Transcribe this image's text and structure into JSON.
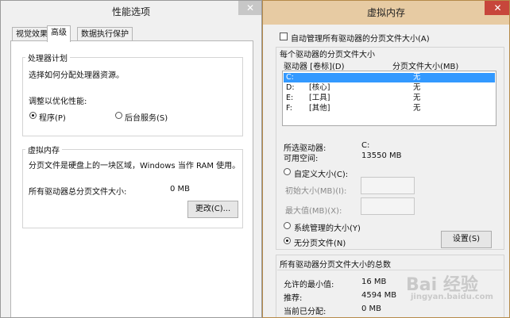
{
  "perf": {
    "title": "性能选项",
    "close": "✕",
    "tabs": [
      "视觉效果",
      "高级",
      "数据执行保护"
    ],
    "cpu": {
      "group_title": "处理器计划",
      "desc": "选择如何分配处理器资源。",
      "adjust_label": "调整以优化性能:",
      "opt_programs": "程序(P)",
      "opt_services": "后台服务(S)"
    },
    "vm": {
      "group_title": "虚拟内存",
      "desc": "分页文件是硬盘上的一块区域，Windows 当作 RAM 使用。",
      "total_label": "所有驱动器总分页文件大小:",
      "total_value": "0 MB",
      "change_button": "更改(C)..."
    }
  },
  "vmem": {
    "title": "虚拟内存",
    "close": "✕",
    "auto_label": "自动管理所有驱动器的分页文件大小(A)",
    "per_drive_title": "每个驱动器的分页文件大小",
    "col_drive": "驱动器 [卷标](D)",
    "col_size": "分页文件大小(MB)",
    "drives": [
      {
        "drive": "C:",
        "label": "",
        "size": "无"
      },
      {
        "drive": "D:",
        "label": "[核心]",
        "size": "无"
      },
      {
        "drive": "E:",
        "label": "[工具]",
        "size": "无"
      },
      {
        "drive": "F:",
        "label": "[其他]",
        "size": "无"
      }
    ],
    "selected_drive_label": "所选驱动器:",
    "selected_drive_value": "C:",
    "free_space_label": "可用空间:",
    "free_space_value": "13550 MB",
    "custom_label": "自定义大小(C):",
    "initial_label": "初始大小(MB)(I):",
    "max_label": "最大值(MB)(X):",
    "system_managed_label": "系统管理的大小(Y)",
    "no_paging_label": "无分页文件(N)",
    "set_button": "设置(S)",
    "total_group_title": "所有驱动器分页文件大小的总数",
    "min_label": "允许的最小值:",
    "min_value": "16 MB",
    "recommended_label": "推荐:",
    "recommended_value": "4594 MB",
    "current_label": "当前已分配:",
    "current_value": "0 MB",
    "watermark_brand": "Bai 经验",
    "watermark_url": "jingyan.baidu.com"
  },
  "colors": {
    "left_close": "#c7c7c7",
    "right_close": "#c7463b",
    "right_titlebar": "#e7cba3",
    "selection": "#3399ff"
  }
}
